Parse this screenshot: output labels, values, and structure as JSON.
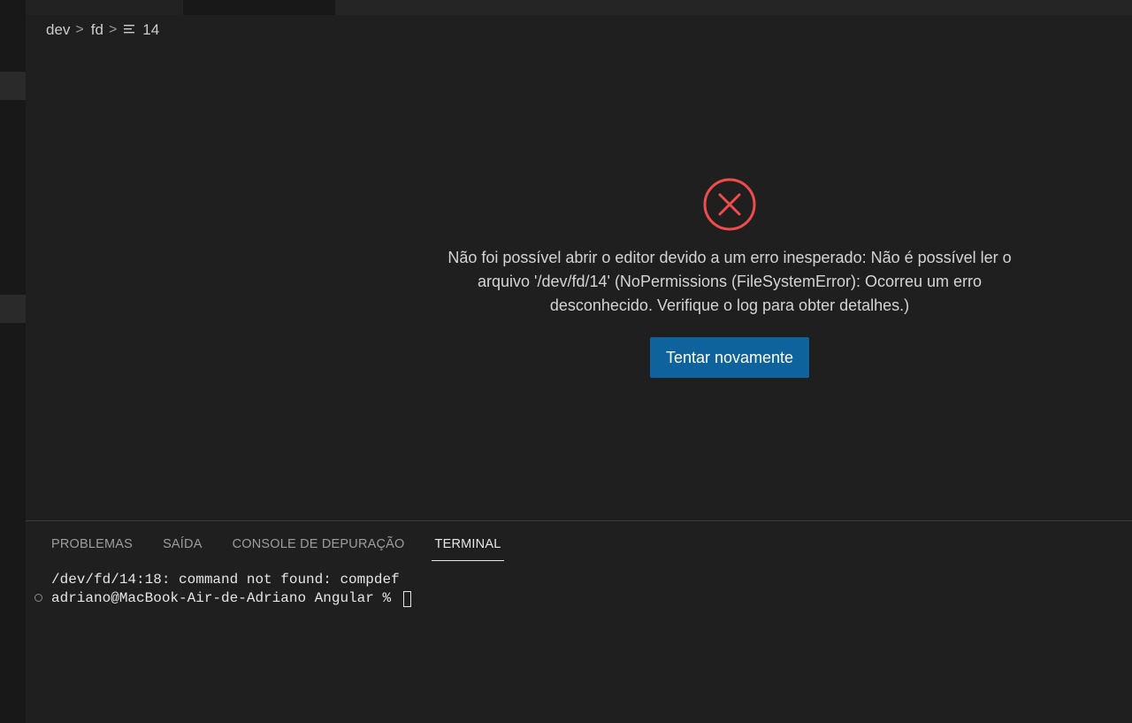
{
  "breadcrumb": {
    "items": [
      "dev",
      "fd"
    ],
    "file": "14",
    "file_icon": "lines-icon"
  },
  "editor_error": {
    "icon": "error-circle-x-icon",
    "icon_color": "#f14c4c",
    "message": "Não foi possível abrir o editor devido a um erro inesperado: Não é possível ler o arquivo '/dev/fd/14' (NoPermissions (FileSystemError): Ocorreu um erro desconhecido. Verifique o log para obter detalhes.)",
    "retry_label": "Tentar novamente",
    "button_color": "#0e639c"
  },
  "panel": {
    "tabs": [
      {
        "label": "PROBLEMAS"
      },
      {
        "label": "SAÍDA"
      },
      {
        "label": "CONSOLE DE DEPURAÇÃO"
      },
      {
        "label": "TERMINAL"
      }
    ],
    "active_tab": "TERMINAL"
  },
  "terminal": {
    "lines": [
      "/dev/fd/14:18: command not found: compdef",
      "adriano@MacBook-Air-de-Adriano Angular % "
    ]
  }
}
